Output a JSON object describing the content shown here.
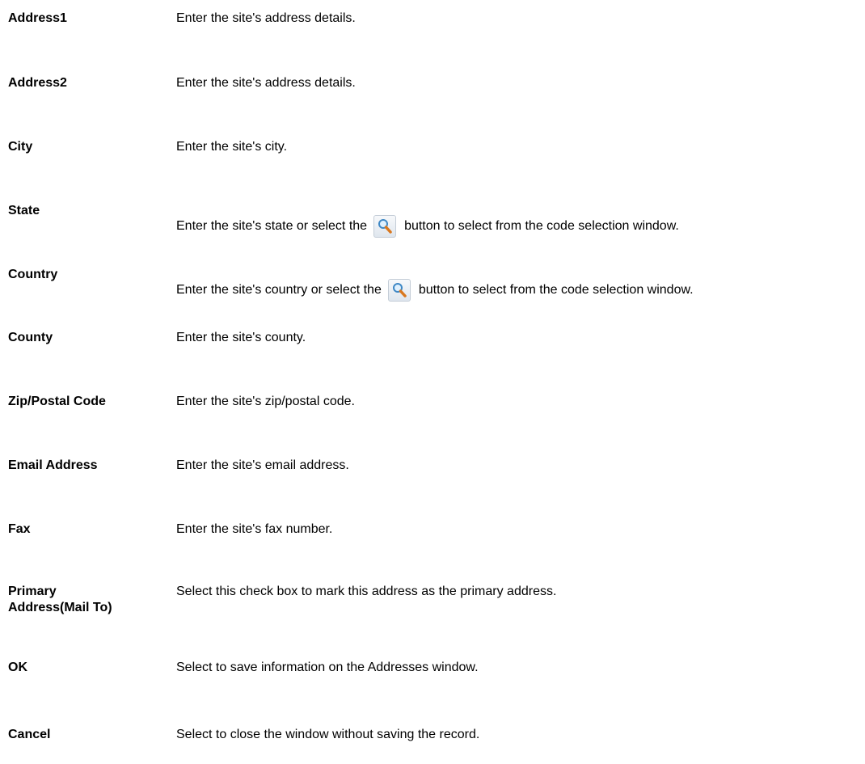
{
  "rows": [
    {
      "term": "Address1",
      "description": "Enter the site's address details."
    },
    {
      "term": "Address2",
      "description": "Enter the site's address details."
    },
    {
      "term": "City",
      "description": "Enter the site's city."
    },
    {
      "term": "State",
      "description_before": "Enter the site's state or select the",
      "description_after": "button to select from the code selection window.",
      "icon": "magnifier-icon"
    },
    {
      "term": "Country",
      "description_before": "Enter the site's country or select the",
      "description_after": "button to select from the code selection window.",
      "icon": "magnifier-icon"
    },
    {
      "term": "County",
      "description": "Enter the site's county."
    },
    {
      "term": "Zip/Postal Code",
      "description": "Enter the site's zip/postal code."
    },
    {
      "term": "Email Address",
      "description": "Enter the site's email address."
    },
    {
      "term": "Fax",
      "description": "Enter the site's fax number."
    },
    {
      "term_line1": "Primary",
      "term_line2": "Address(Mail To)",
      "description": "Select this check box to mark this address as the primary address."
    },
    {
      "term": "OK",
      "description": "Select to save information on the Addresses window."
    },
    {
      "term": "Cancel",
      "description": "Select to close the window without saving the record."
    }
  ]
}
